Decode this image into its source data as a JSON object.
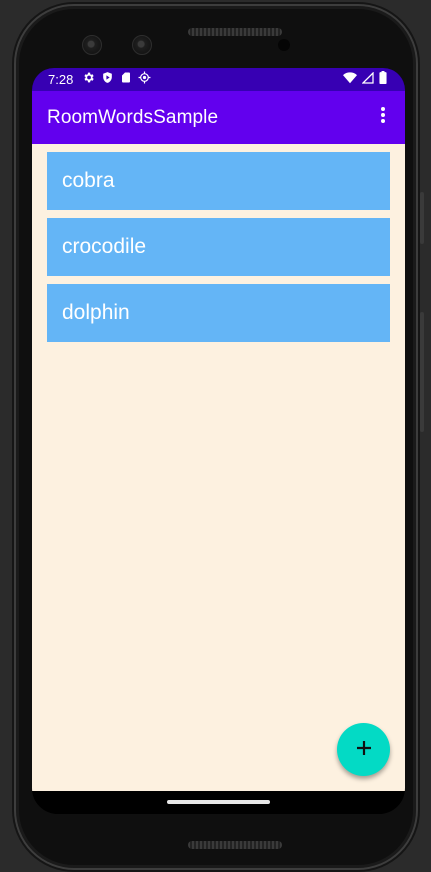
{
  "status_bar": {
    "time": "7:28",
    "left_icons": [
      "settings-icon",
      "play-protect-icon",
      "sd-card-icon",
      "location-crosshair-icon"
    ],
    "right_icons": [
      "wifi-icon",
      "cell-signal-icon",
      "battery-icon"
    ]
  },
  "app_bar": {
    "title": "RoomWordsSample",
    "menu_icon": "more-vert-icon"
  },
  "word_list": {
    "items": [
      {
        "label": "cobra"
      },
      {
        "label": "crocodile"
      },
      {
        "label": "dolphin"
      }
    ]
  },
  "fab": {
    "icon": "add-icon"
  },
  "colors": {
    "status_bar": "#3700b3",
    "app_bar": "#6200ee",
    "list_background": "#fdf1e0",
    "item_background": "#64b5f6",
    "fab": "#03dac5"
  }
}
